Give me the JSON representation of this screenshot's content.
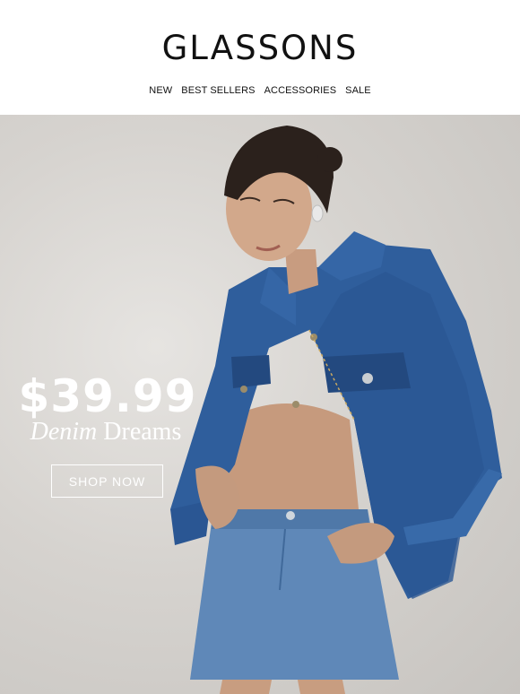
{
  "brand": {
    "logo_text": "GLASSONS"
  },
  "nav": {
    "items": [
      {
        "label": "NEW"
      },
      {
        "label": "BEST SELLERS"
      },
      {
        "label": "ACCESSORIES"
      },
      {
        "label": "SALE"
      }
    ]
  },
  "hero": {
    "price": "$39.99",
    "tagline_italic": "Denim",
    "tagline_rest": "Dreams",
    "cta_label": "SHOP NOW",
    "image_description_icon": "model-photo"
  },
  "colors": {
    "background": "#ffffff",
    "hero_backdrop": "#d6d3cf",
    "denim": "#2e5c9a",
    "text_dark": "#111111",
    "text_light": "#ffffff"
  }
}
